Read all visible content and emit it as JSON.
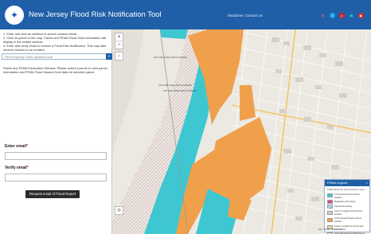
{
  "header": {
    "title": "New Jersey Flood Risk Notification Tool",
    "links": "Disclaimer | Contact Us"
  },
  "colors": {
    "header_bg": "#1f5fa8",
    "flood_orange": "#f0a04b",
    "floodway_cyan": "#3ec7d1",
    "button_dark": "#2b2b2b"
  },
  "panel": {
    "instructions": [
      "1. Enter and click an address in search window below,",
      "2. Click on parcel in the map. Parcel and FEMA Flood Zone information will display in the middle window.",
      "3. Enter and verify email to receive a Flood Risk Notification. This may take several minutes to be emailed."
    ],
    "search_placeholder": "Find Property: Enter address here",
    "parcel_info": "Parcel and FEMA Information Window. Please select a parcel to view parcel information and FEMA Flood Hazard Zone data for selected parcel.",
    "email_label": "Enter email",
    "verify_label": "Verify email",
    "required_mark": "*",
    "submit_label": "Request email of Flood Report"
  },
  "map": {
    "labels": [
      "CUT-OFF SHALLOW FLOODING",
      "CUT-OFF SHALLOW FLOODING",
      "CUT-OFF SHALLOW FLOODING"
    ]
  },
  "legend": {
    "title": "FEMA Legend",
    "close": "×",
    "subtitle": "FEMA National Flood Hazard Layer",
    "items": [
      {
        "label": "1% Annual Chance Flood Hazard",
        "color": "#3ec7d1"
      },
      {
        "label": "Regulatory Floodway",
        "color": "#d94c8a"
      },
      {
        "label": "Special Floodway",
        "color": "#a8d8f0"
      },
      {
        "label": "Area of Undetermined Flood Hazard",
        "color": "#cfcfcf"
      },
      {
        "label": "0.2% Annual Chance Flood Hazard",
        "color": "#f0a04b"
      },
      {
        "label": "Future Conditions 1% Annual Chance",
        "color": "#f5d29c"
      },
      {
        "label": "Area with Reduced Risk Due to Levee",
        "color": "#e7e1b0"
      },
      {
        "label": "Area with Risk Due to Levee",
        "color": "#e8c86a"
      }
    ]
  },
  "credit": "Esri, HERE, Garmin, USGS"
}
